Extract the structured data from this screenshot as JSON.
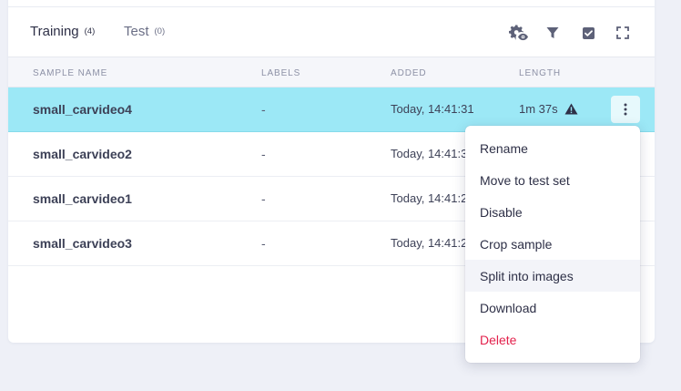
{
  "tabs": [
    {
      "label": "Training",
      "count": "(4)"
    },
    {
      "label": "Test",
      "count": "(0)"
    }
  ],
  "toolbar": {
    "icons": [
      "settings-eye-icon",
      "filter-icon",
      "checkbox-icon",
      "fullscreen-icon"
    ]
  },
  "table": {
    "columns": [
      "SAMPLE NAME",
      "LABELS",
      "ADDED",
      "LENGTH"
    ],
    "rows": [
      {
        "name": "small_carvideo4",
        "labels": "-",
        "added": "Today, 14:41:31",
        "length": "1m 37s",
        "warning": true,
        "selected": true
      },
      {
        "name": "small_carvideo2",
        "labels": "-",
        "added": "Today, 14:41:31",
        "length": "",
        "warning": false,
        "selected": false
      },
      {
        "name": "small_carvideo1",
        "labels": "-",
        "added": "Today, 14:41:21",
        "length": "",
        "warning": false,
        "selected": false
      },
      {
        "name": "small_carvideo3",
        "labels": "-",
        "added": "Today, 14:41:21",
        "length": "",
        "warning": false,
        "selected": false
      }
    ]
  },
  "context_menu": {
    "items": [
      {
        "label": "Rename"
      },
      {
        "label": "Move to test set"
      },
      {
        "label": "Disable"
      },
      {
        "label": "Crop sample"
      },
      {
        "label": "Split into images",
        "hovered": true
      },
      {
        "label": "Download"
      },
      {
        "label": "Delete",
        "danger": true
      }
    ]
  },
  "colors": {
    "selected_row": "#9ce8f6",
    "danger": "#e3214c",
    "page_bg": "#eef0f7"
  }
}
